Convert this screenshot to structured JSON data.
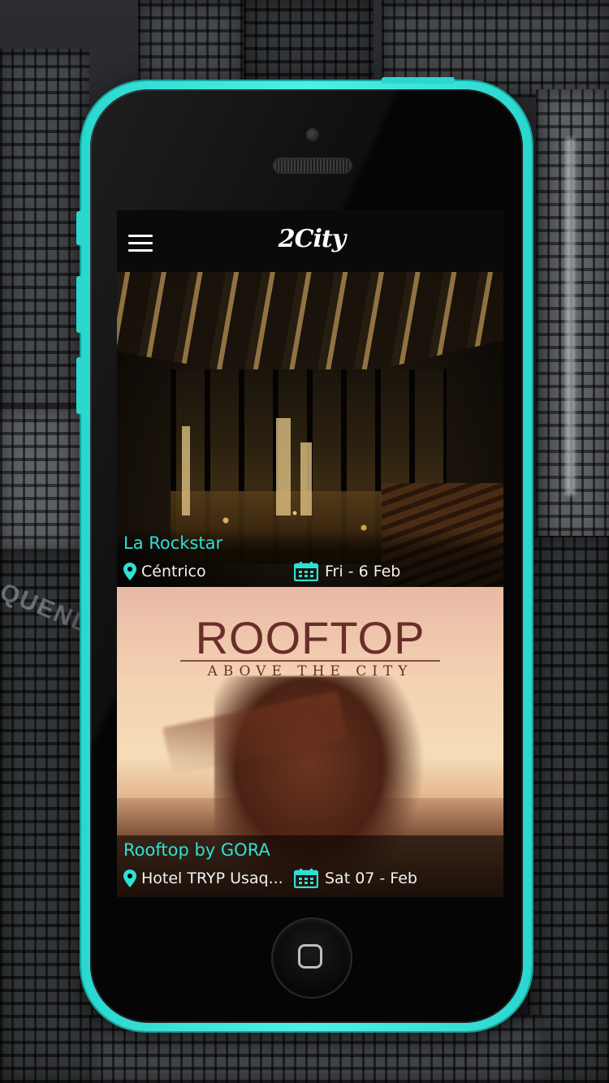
{
  "app": {
    "logo_text": "2City"
  },
  "events": [
    {
      "name": "La Rockstar",
      "location": "Céntrico",
      "date": "Fri - 6 Feb"
    },
    {
      "name": "Rooftop by GORA",
      "location": "Hotel TRYP Usaq...",
      "date": "Sat 07 - Feb",
      "poster_title": "ROOFTOP",
      "poster_subtitle": "ABOVE THE CITY"
    }
  ],
  "backdrop": {
    "sign_text": "QUENDO"
  },
  "colors": {
    "accent": "#2ee0d4",
    "phone_case": "#2ad7cf",
    "screen_bg": "#000000"
  },
  "icons": {
    "menu": "hamburger-icon",
    "location": "map-pin-icon",
    "date": "calendar-icon",
    "home": "home-button-icon"
  }
}
